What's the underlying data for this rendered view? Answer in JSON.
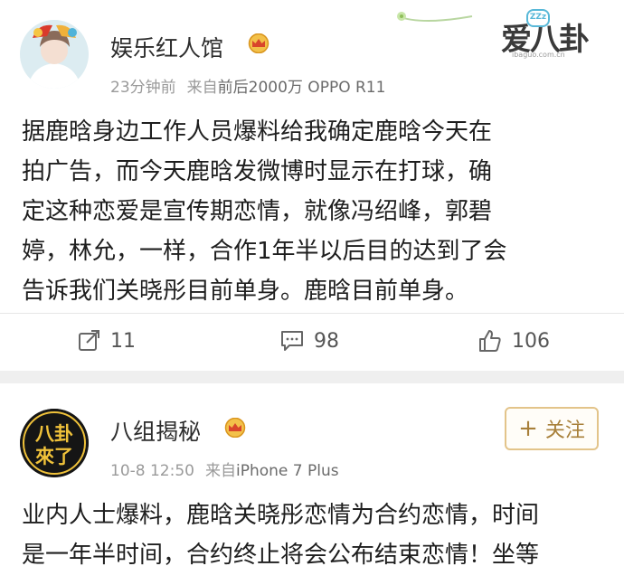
{
  "post1": {
    "author": "娱乐红人馆",
    "time": "23分钟前",
    "source_prefix": "来自",
    "source": "前后2000万 OPPO R11",
    "lines": [
      "据鹿晗身边工作人员爆料给我确定鹿晗今天在",
      "拍广告，而今天鹿晗发微博时显示在打球，确",
      "定这种恋爱是宣传期恋情，就像冯绍峰，郭碧",
      "婷，林允，一样，合作1年半以后目的达到了会",
      "告诉我们关晓彤目前单身。鹿晗目前单身。"
    ],
    "actions": {
      "repost_count": "11",
      "comment_count": "98",
      "like_count": "106"
    }
  },
  "post2": {
    "author": "八组揭秘",
    "avatar_text_top": "八卦",
    "avatar_text_bottom": "來了",
    "time": "10-8 12:50",
    "source_prefix": "来自",
    "source": "iPhone 7 Plus",
    "follow_label": "关注",
    "lines": [
      "业内人士爆料，鹿晗关晓彤恋情为合约恋情，时间",
      "是一年半时间，合约终止将会公布结束恋情！坐等"
    ]
  },
  "watermark": {
    "logo_text": "爱八卦",
    "logo_url": "ibaguo.com.cn",
    "zz_text": "ZZz"
  },
  "colors": {
    "gold": "#a8803a",
    "meta_gray": "#9a9a9a",
    "background": "#efefef"
  },
  "icons": [
    "repost-icon",
    "comment-icon",
    "like-icon",
    "vip-crown-icon",
    "plus-icon"
  ]
}
